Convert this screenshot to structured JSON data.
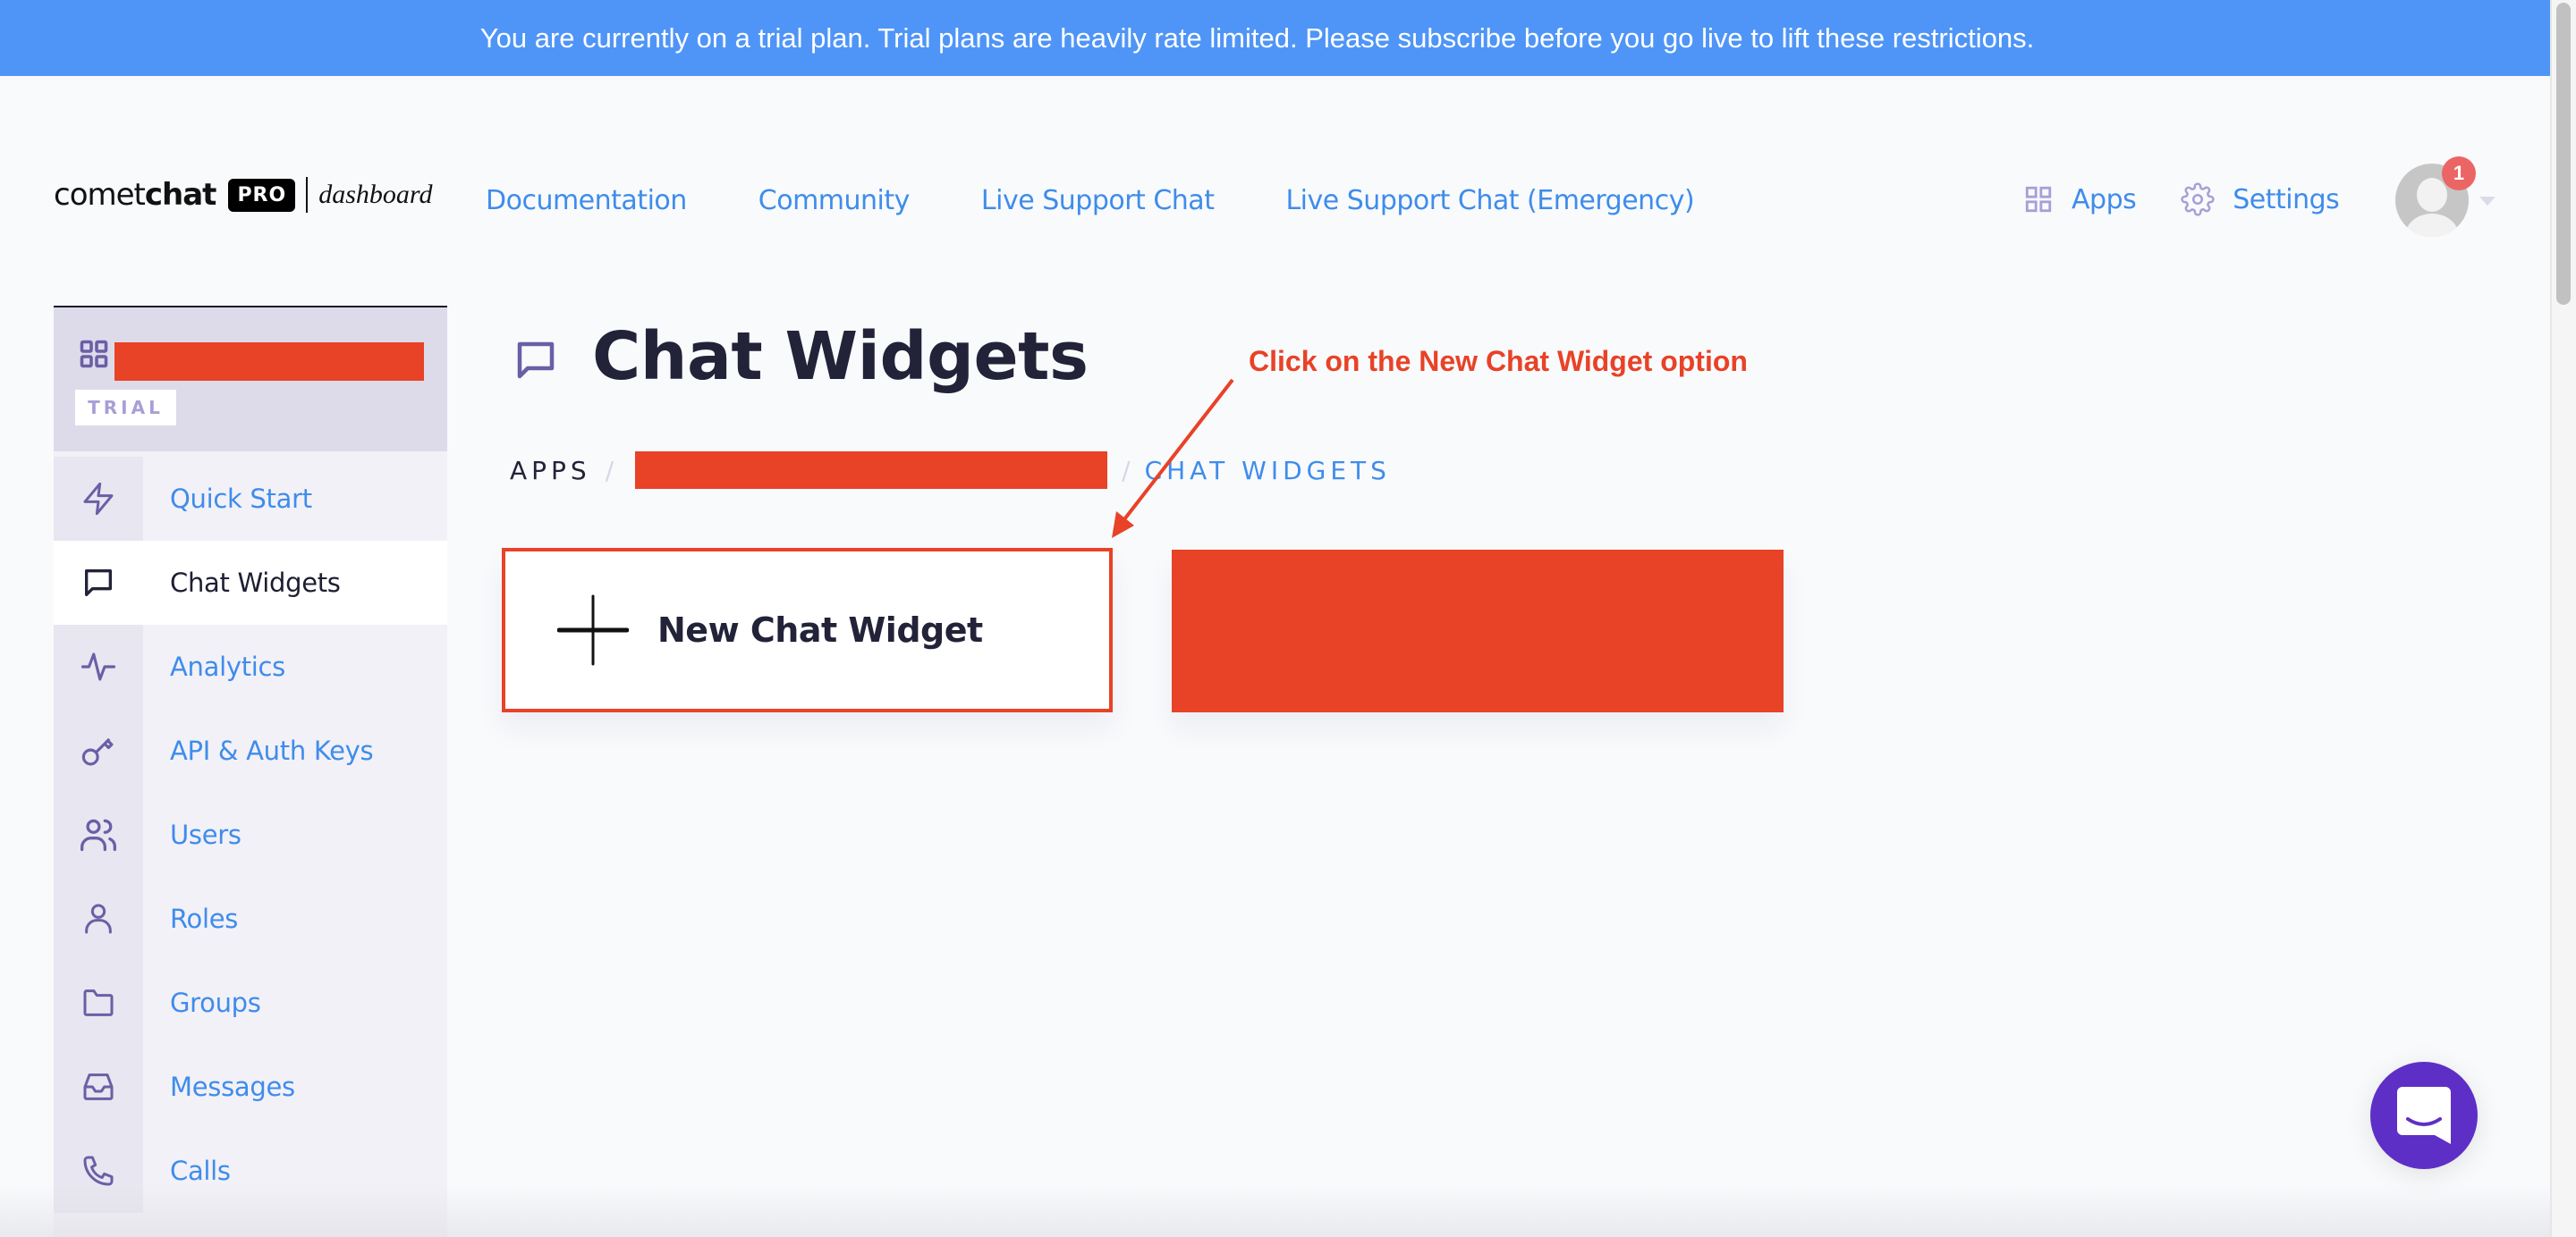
{
  "banner": {
    "text": "You are currently on a trial plan. Trial plans are heavily rate limited. Please subscribe before you go live to lift these restrictions.",
    "color": "#4F95F7"
  },
  "logo": {
    "comet": "comet",
    "chat": "chat",
    "pro": "PRO",
    "dashboard": "dashboard"
  },
  "topnav": [
    {
      "label": "Documentation"
    },
    {
      "label": "Community"
    },
    {
      "label": "Live Support Chat"
    },
    {
      "label": "Live Support Chat (Emergency)"
    }
  ],
  "header_right": {
    "apps": {
      "label": "Apps",
      "icon": "grid-icon"
    },
    "settings": {
      "label": "Settings",
      "icon": "gear-icon"
    },
    "notification_count": "1"
  },
  "sidebar": {
    "app_badge": "TRIAL",
    "items": [
      {
        "label": "Quick Start",
        "icon": "lightning-icon",
        "active": false
      },
      {
        "label": "Chat Widgets",
        "icon": "chat-bubble-icon",
        "active": true
      },
      {
        "label": "Analytics",
        "icon": "activity-icon",
        "active": false
      },
      {
        "label": "API & Auth Keys",
        "icon": "key-icon",
        "active": false
      },
      {
        "label": "Users",
        "icon": "users-icon",
        "active": false
      },
      {
        "label": "Roles",
        "icon": "user-icon",
        "active": false
      },
      {
        "label": "Groups",
        "icon": "folder-icon",
        "active": false
      },
      {
        "label": "Messages",
        "icon": "inbox-icon",
        "active": false
      },
      {
        "label": "Calls",
        "icon": "phone-icon",
        "active": false
      }
    ]
  },
  "main": {
    "title": "Chat Widgets",
    "breadcrumb": {
      "root": "APPS",
      "separator": "/",
      "current": "CHAT WIDGETS"
    },
    "new_widget_label": "New Chat Widget",
    "annotation": "Click on the New Chat Widget option"
  },
  "colors": {
    "accent_blue": "#3F8CEB",
    "redaction": "#E84227",
    "sidebar_icon": "#6A5FA6",
    "intercom": "#5E2FC6",
    "badge": "#EB6565"
  }
}
